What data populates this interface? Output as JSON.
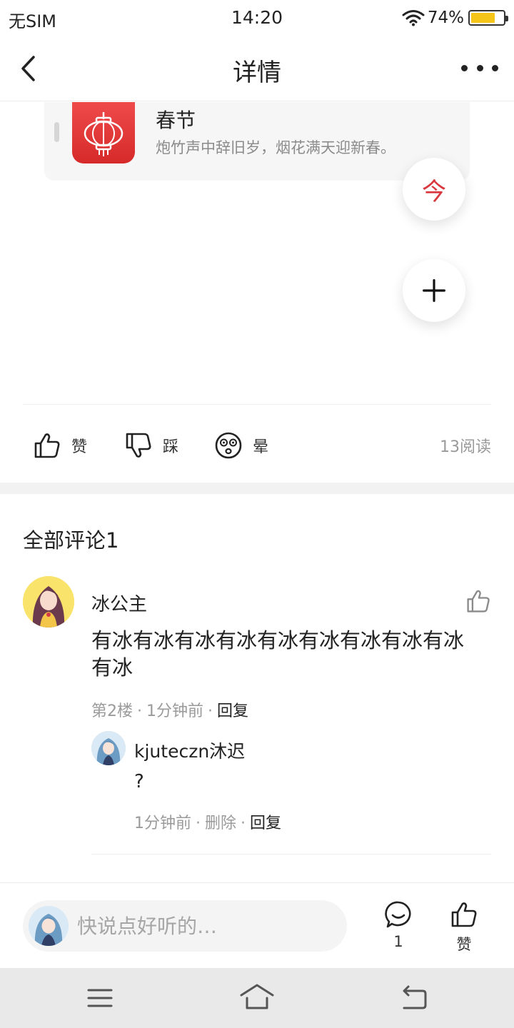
{
  "status_bar": {
    "carrier": "无SIM",
    "time": "14:20",
    "battery_percent": "74%",
    "battery_level": 0.74,
    "battery_color": "#f6c51a"
  },
  "nav": {
    "title": "详情",
    "back_icon": "chevron-left-icon",
    "more_icon": "more-dots-icon"
  },
  "card": {
    "title": "春节",
    "subtitle": "炮竹声中辞旧岁，烟花满天迎新春。",
    "icon": "lantern-icon",
    "icon_color": "#e43b3b"
  },
  "fab": {
    "today_glyph": "今",
    "today_color": "#d9363e",
    "add_icon": "plus-icon"
  },
  "reactions": {
    "like_label": "赞",
    "dislike_label": "踩",
    "dizzy_label": "晕",
    "read_count": "13阅读"
  },
  "comments": {
    "title": "全部评论1",
    "items": [
      {
        "author": "冰公主",
        "body": "有冰有冰有冰有冰有冰有冰有冰有冰有冰有冰",
        "floor": "第2楼",
        "time": "1分钟前",
        "reply_label": "回复",
        "replies": [
          {
            "author": "kjuteczn沐迟",
            "body": "?",
            "time": "1分钟前",
            "delete_label": "删除",
            "reply_label": "回复"
          }
        ]
      }
    ]
  },
  "bottom_bar": {
    "input_placeholder": "快说点好听的…",
    "comment_count": "1",
    "like_label": "赞"
  },
  "system_nav": {
    "menu_icon": "menu-icon",
    "home_icon": "home-icon",
    "back_icon": "back-icon"
  }
}
